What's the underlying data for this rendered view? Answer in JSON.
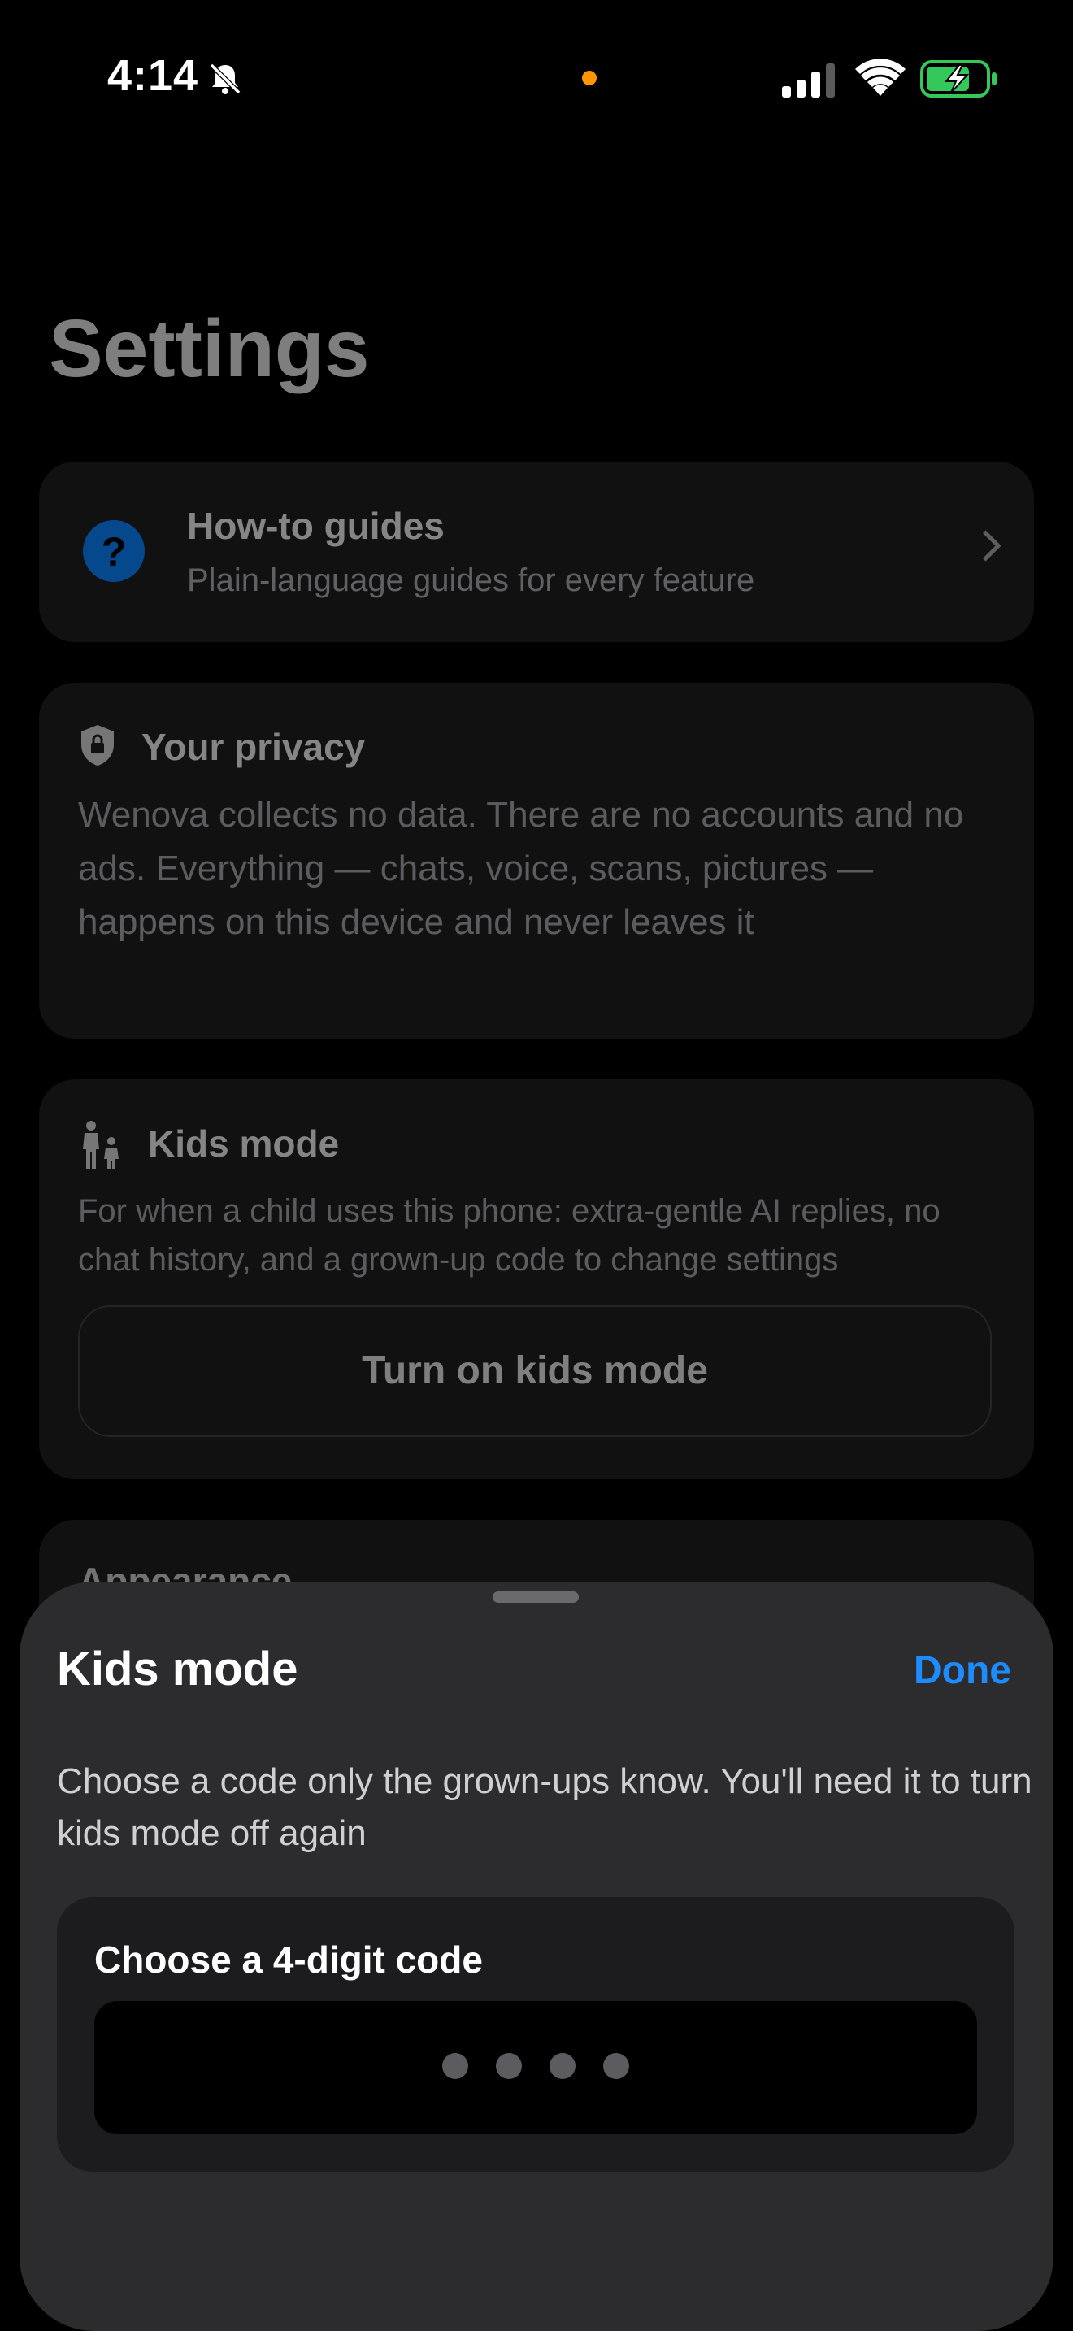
{
  "status_bar": {
    "time": "4:14",
    "icons": [
      "bell-slash-icon",
      "signal-icon",
      "wifi-icon",
      "battery-charging-icon"
    ],
    "indicator_color": "#ff9500",
    "battery_color": "#34c759"
  },
  "page": {
    "title": "Settings"
  },
  "guides_card": {
    "title": "How-to guides",
    "subtitle": "Plain-language guides for every feature",
    "icon": "question-circle-icon",
    "icon_glyph": "?"
  },
  "privacy_card": {
    "title": "Your privacy",
    "icon": "shield-lock-icon",
    "body": "Wenova collects no data. There are no accounts and no ads. Everything — chats, voice, scans, pictures — happens on this device and never leaves it"
  },
  "kids_card": {
    "title": "Kids mode",
    "icon": "family-icon",
    "body": "For when a child uses this phone: extra-gentle AI replies, no chat history, and a grown-up code to change settings",
    "button_label": "Turn on kids mode"
  },
  "appearance_card": {
    "title": "Appearance"
  },
  "sheet": {
    "title": "Kids mode",
    "done_label": "Done",
    "description": "Choose a code only the grown-ups know. You'll need it to turn kids mode off again",
    "code_label": "Choose a 4-digit code",
    "code_digits_entered": 0,
    "code_length": 4,
    "accent_color": "#1c8cff"
  }
}
